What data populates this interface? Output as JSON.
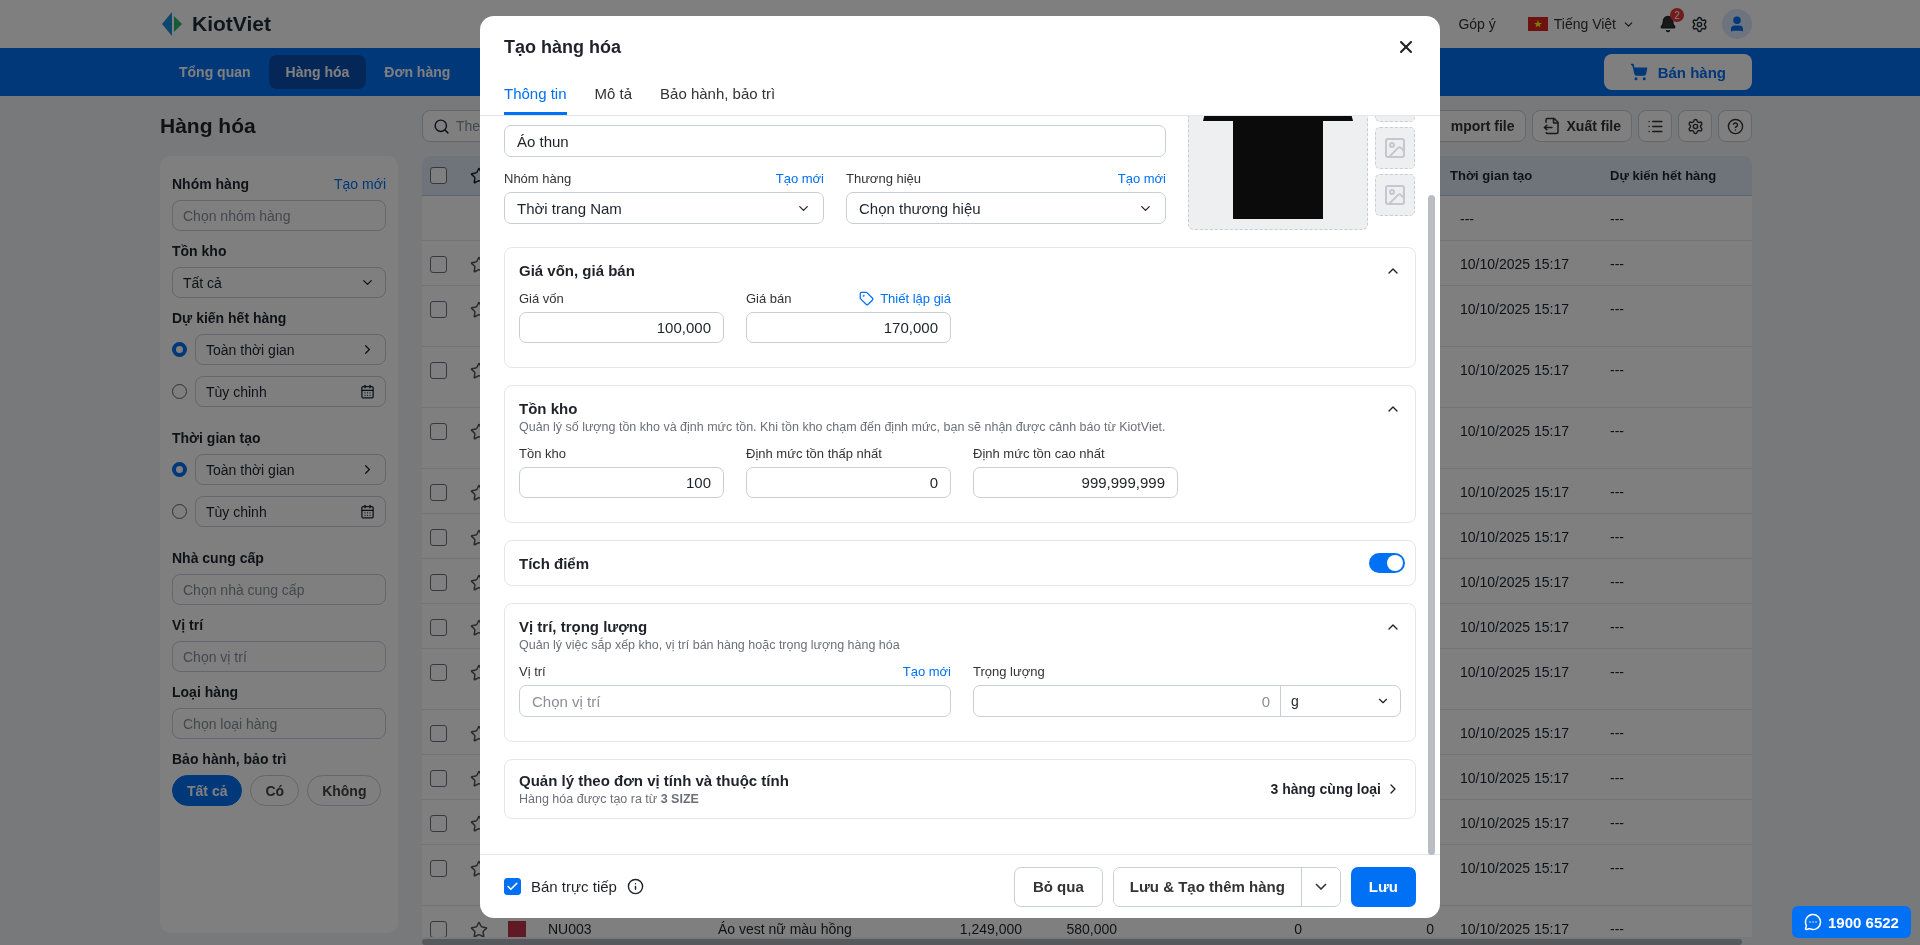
{
  "header": {
    "logo": "KiotViet",
    "feedback": "Góp ý",
    "language": "Tiếng Việt",
    "notifications": "2"
  },
  "nav": {
    "items": [
      {
        "label": "Tổng quan",
        "selected": false
      },
      {
        "label": "Hàng hóa",
        "selected": true
      },
      {
        "label": "Đơn hàng",
        "selected": false
      }
    ],
    "sell_button": "Bán hàng"
  },
  "page": {
    "title": "Hàng hóa",
    "search": {
      "placeholder": "The"
    },
    "actions": [
      "mport file",
      "Xuất file"
    ]
  },
  "sidebar": {
    "sections": [
      {
        "kind": "field",
        "title": "Nhóm hàng",
        "link": "Tạo mới",
        "placeholder": "Chọn nhóm hàng"
      },
      {
        "kind": "select",
        "title": "Tồn kho",
        "value": "Tất cả"
      },
      {
        "kind": "radios",
        "title": "Dự kiến hết hàng",
        "options": [
          {
            "kind": "range",
            "label": "Toàn thời gian",
            "selected": true
          },
          {
            "kind": "custom",
            "label": "Tùy chỉnh",
            "selected": false
          }
        ]
      },
      {
        "kind": "radios",
        "title": "Thời gian tạo",
        "options": [
          {
            "kind": "range",
            "label": "Toàn thời gian",
            "selected": true
          },
          {
            "kind": "custom",
            "label": "Tùy chỉnh",
            "selected": false
          }
        ]
      },
      {
        "kind": "field",
        "title": "Nhà cung cấp",
        "placeholder": "Chọn nhà cung cấp"
      },
      {
        "kind": "field",
        "title": "Vị trí",
        "placeholder": "Chọn vị trí"
      },
      {
        "kind": "field",
        "title": "Loại hàng",
        "placeholder": "Chọn loại hàng"
      },
      {
        "kind": "pills",
        "title": "Bảo hành, bảo trì",
        "options": [
          {
            "label": "Tất cả",
            "selected": true
          },
          {
            "label": "Có",
            "selected": false
          },
          {
            "label": "Không",
            "selected": false
          }
        ]
      }
    ]
  },
  "table": {
    "columns": [
      "Thời gian tạo",
      "Dự kiến hết hàng"
    ],
    "header_checked": false,
    "rows": [
      {
        "kind": "summary",
        "created": "---",
        "expected": "---"
      },
      {
        "kind": "item",
        "checked": false,
        "starred": false,
        "created": "10/10/2025 15:17",
        "expected": "---"
      },
      {
        "kind": "item",
        "checked": false,
        "starred": false,
        "created": "10/10/2025 15:17",
        "expected": "---"
      },
      {
        "kind": "item",
        "checked": false,
        "starred": false,
        "created": "10/10/2025 15:17",
        "expected": "---"
      },
      {
        "kind": "item",
        "checked": false,
        "starred": false,
        "created": "10/10/2025 15:17",
        "expected": "---"
      },
      {
        "kind": "item",
        "checked": false,
        "starred": false,
        "created": "10/10/2025 15:17",
        "expected": "---"
      },
      {
        "kind": "item",
        "checked": false,
        "starred": false,
        "created": "10/10/2025 15:17",
        "expected": "---"
      },
      {
        "kind": "item",
        "checked": false,
        "starred": false,
        "created": "10/10/2025 15:17",
        "expected": "---"
      },
      {
        "kind": "item",
        "checked": false,
        "starred": false,
        "created": "10/10/2025 15:17",
        "expected": "---"
      },
      {
        "kind": "item",
        "checked": false,
        "starred": false,
        "created": "10/10/2025 15:17",
        "expected": "---"
      },
      {
        "kind": "item",
        "checked": false,
        "starred": false,
        "created": "10/10/2025 15:17",
        "expected": "---"
      },
      {
        "kind": "item",
        "checked": false,
        "starred": false,
        "created": "10/10/2025 15:17",
        "expected": "---"
      },
      {
        "kind": "item",
        "checked": false,
        "starred": false,
        "created": "10/10/2025 15:17",
        "expected": "---"
      },
      {
        "kind": "item",
        "checked": false,
        "starred": false,
        "created": "10/10/2025 15:17",
        "expected": "---"
      },
      {
        "kind": "item",
        "checked": false,
        "starred": false,
        "cells": [
          "NU003",
          "Áo vest nữ màu hồng",
          "1,249,000",
          "580,000",
          "0",
          "0"
        ],
        "created": "10/10/2025 15:17",
        "expected": "---"
      }
    ]
  },
  "dialog": {
    "title": "Tạo hàng hóa",
    "tabs": [
      {
        "label": "Thông tin",
        "selected": true
      },
      {
        "label": "Mô tả",
        "selected": false
      },
      {
        "label": "Bảo hành, bảo trì",
        "selected": false
      }
    ],
    "name_field": {
      "value": "Áo thun"
    },
    "group": {
      "label": "Nhóm hàng",
      "link": "Tạo mới",
      "value": "Thời trang Nam"
    },
    "brand": {
      "label": "Thương hiệu",
      "link": "Tạo mới",
      "value": "Chọn thương hiệu"
    },
    "sections": [
      {
        "kind": "prices",
        "title": "Giá vốn, giá bán",
        "expanded": true,
        "fields": [
          {
            "label": "Giá vốn",
            "value": "100,000"
          },
          {
            "label": "Giá bán",
            "value": "170,000",
            "link": "Thiết lập giá"
          }
        ]
      },
      {
        "kind": "fields",
        "title": "Tồn kho",
        "description": "Quản lý số lượng tồn kho và định mức tồn. Khi tồn kho chạm đến định mức, bạn sẽ nhận được cảnh báo từ KiotViet.",
        "expanded": true,
        "fields": [
          {
            "label": "Tồn kho",
            "value": "100"
          },
          {
            "label": "Định mức tồn thấp nhất",
            "value": "0"
          },
          {
            "label": "Định mức tồn cao nhất",
            "value": "999,999,999"
          }
        ]
      },
      {
        "kind": "toggle",
        "title": "Tích điểm",
        "on": true
      },
      {
        "kind": "location",
        "title": "Vị trí, trọng lượng",
        "description": "Quản lý việc sắp xếp kho, vị trí bán hàng hoặc trọng lượng hàng hóa",
        "expanded": true,
        "location": {
          "label": "Vị trí",
          "link": "Tạo mới",
          "placeholder": "Chọn vị trí"
        },
        "weight": {
          "label": "Trọng lượng",
          "placeholder": "0",
          "unit": "g"
        }
      },
      {
        "kind": "link",
        "title": "Quản lý theo đơn vị tính và thuộc tính",
        "description": "Hàng hóa được tạo ra từ **3 SIZE**",
        "action": "3 hàng cùng loại"
      }
    ],
    "direct_sale": {
      "label": "Bán trực tiếp",
      "checked": true
    },
    "buttons": [
      {
        "kind": "secondary",
        "label": "Bỏ qua"
      },
      {
        "kind": "split",
        "label": "Lưu & Tạo thêm hàng"
      },
      {
        "kind": "primary",
        "label": "Lưu"
      }
    ]
  },
  "hotline": "1900 6522"
}
